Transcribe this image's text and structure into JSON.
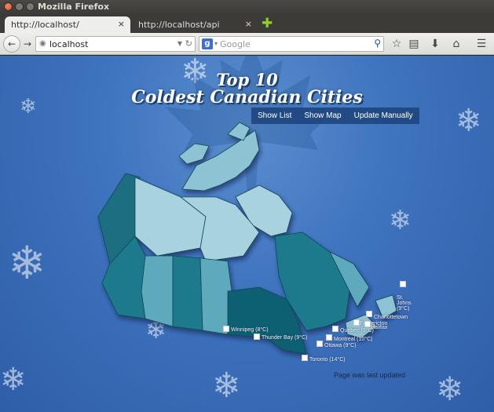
{
  "window": {
    "title": "Mozilla Firefox"
  },
  "tabs": [
    {
      "label": "http://localhost/",
      "close": "×"
    },
    {
      "label": "http://localhost/api",
      "close": "×"
    }
  ],
  "newtab": "✚",
  "nav": {
    "back": "←",
    "forward": "→",
    "url": "localhost",
    "search_engine": "g",
    "search_placeholder": "Google",
    "icons": [
      "search-icon",
      "star-icon",
      "clipboard-icon",
      "download-icon",
      "home-icon",
      "menu-icon"
    ]
  },
  "page": {
    "title_line1": "Top 10",
    "title_line2": "Coldest Canadian Cities",
    "menu": [
      "Show List",
      "Show Map",
      "Update Manually"
    ],
    "cities": [
      {
        "label": "Winnipeg (8°C)"
      },
      {
        "label": "Thunder Bay (9°C)"
      },
      {
        "label": "Toronto (14°C)"
      },
      {
        "label": "Ottawa (9°C)"
      },
      {
        "label": "Montreal (10°C)"
      },
      {
        "label": "Quebec (9°C)"
      },
      {
        "label": "Fredericton"
      },
      {
        "label": "Halifax"
      },
      {
        "label": "Charlottetown"
      },
      {
        "label": "St. Johns (9°C)"
      }
    ],
    "updated": "Page was last updated"
  },
  "colors": {
    "accent": "#1c427a",
    "map_dark": "#1a6e80",
    "map_light": "#8ec3d4"
  }
}
